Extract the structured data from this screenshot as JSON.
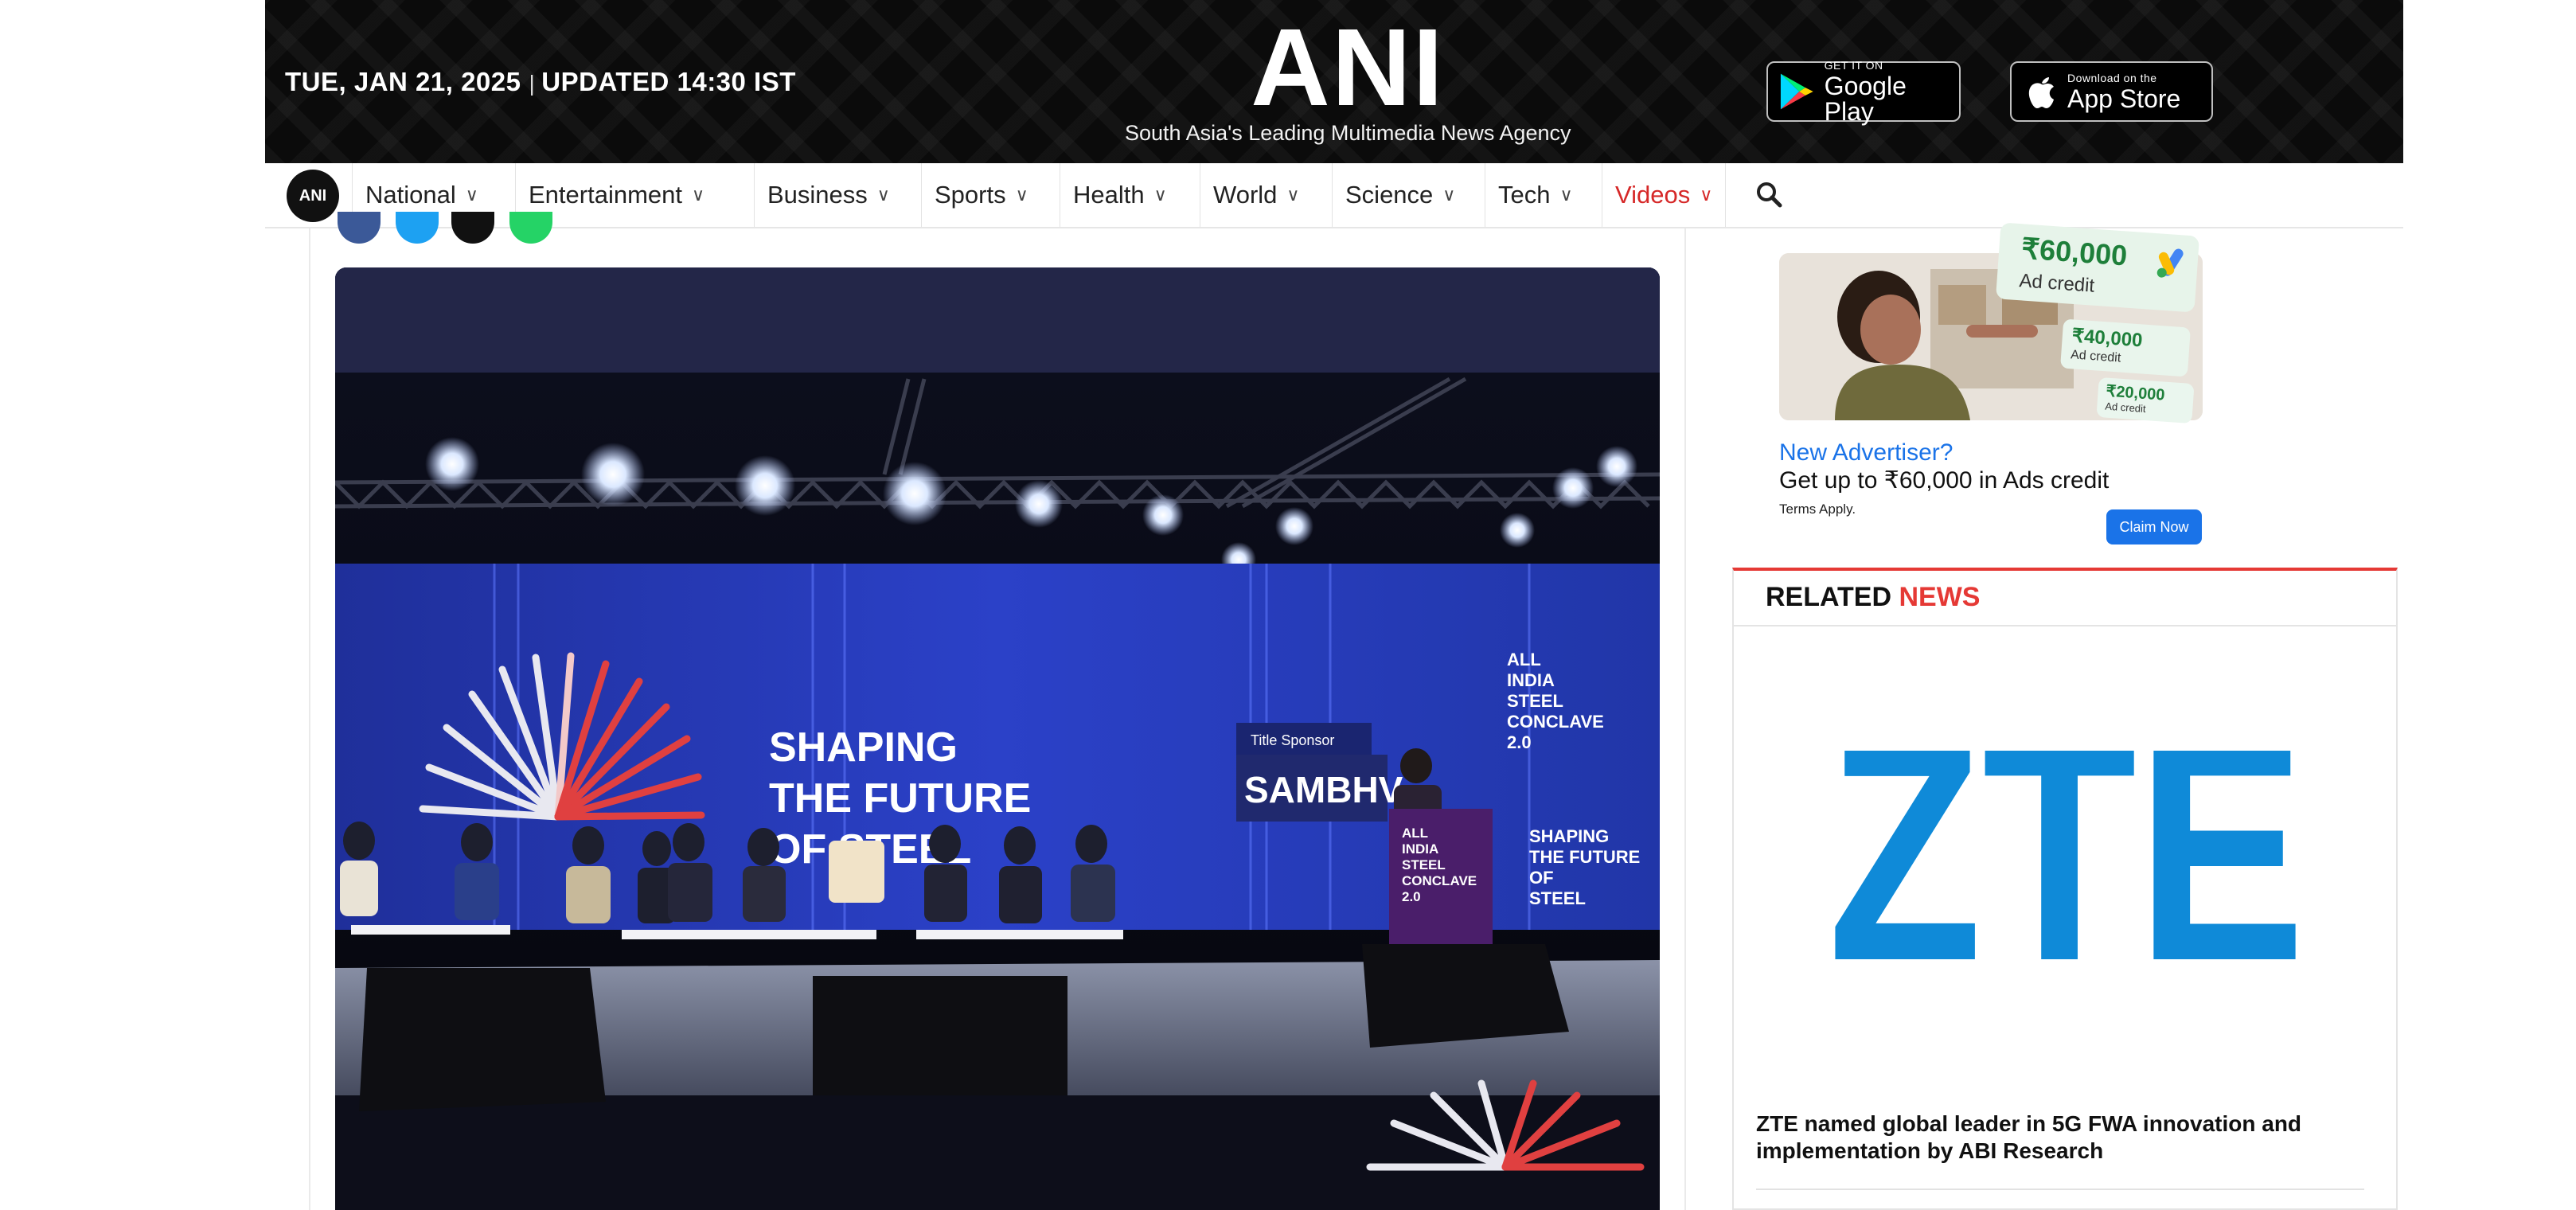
{
  "header": {
    "date": "TUE, JAN 21, 2025",
    "separator": "|",
    "updated": "UPDATED 14:30 IST",
    "brand": "ANI",
    "tagline": "South Asia's Leading Multimedia News Agency",
    "google_play": {
      "small": "GET IT ON",
      "big": "Google Play"
    },
    "app_store": {
      "small": "Download on the",
      "big": "App Store"
    }
  },
  "nav": {
    "logo_text": "ANI",
    "items": [
      {
        "label": "National"
      },
      {
        "label": "Entertainment"
      },
      {
        "label": "Business"
      },
      {
        "label": "Sports"
      },
      {
        "label": "Health"
      },
      {
        "label": "World"
      },
      {
        "label": "Science"
      },
      {
        "label": "Tech"
      },
      {
        "label": "Videos"
      }
    ],
    "chevron": "⌄",
    "search_icon": "search-icon"
  },
  "article": {
    "photo": {
      "stage_line1": "SHAPING",
      "stage_line2": "THE FUTURE",
      "stage_line3": "OF STEEL",
      "sponsor": "SAMBHV",
      "title_sponsor": "Title Sponsor",
      "right_screen": [
        "ALL",
        "INDIA",
        "STEEL",
        "CONCLAVE",
        "2.0"
      ],
      "right_screen_tag": [
        "SHAPING",
        "THE FUTURE",
        "OF",
        "STEEL"
      ],
      "podium": [
        "ALL",
        "INDIA",
        "STEEL",
        "CONCLAVE",
        "2.0"
      ]
    }
  },
  "ad": {
    "credit_big": "₹60,000",
    "credit_big_label": "Ad credit",
    "credit_mid": "₹40,000",
    "credit_mid_label": "Ad credit",
    "credit_small": "₹20,000",
    "credit_small_label": "Ad credit",
    "question": "New Advertiser?",
    "headline": "Get up to ₹60,000 in Ads credit",
    "terms": "Terms Apply.",
    "cta": "Claim Now"
  },
  "related": {
    "title_part1": "RELATED",
    "title_part2": "NEWS",
    "logo_text": "ZTE",
    "headline": "ZTE named global leader in 5G FWA innovation and implementation by ABI Research"
  },
  "colors": {
    "header_bg": "#0b0b0b",
    "accent_red": "#e53935",
    "link_blue": "#1a73e8",
    "zte_blue": "#0f8ad8"
  }
}
